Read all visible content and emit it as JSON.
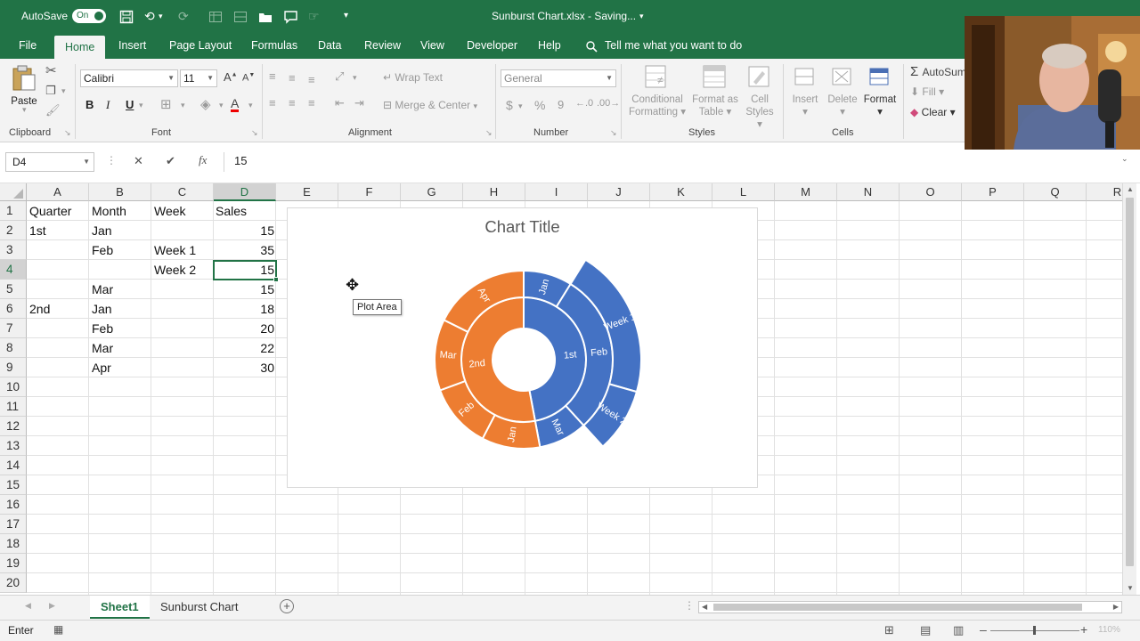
{
  "titlebar": {
    "autosave_label": "AutoSave",
    "autosave_state": "On",
    "filename": "Sunburst Chart.xlsx  -  Saving...",
    "bg_color": "#217346"
  },
  "menu": {
    "tabs": [
      "File",
      "Home",
      "Insert",
      "Page Layout",
      "Formulas",
      "Data",
      "Review",
      "View",
      "Developer",
      "Help"
    ],
    "active_tab": "Home",
    "tell_me": "Tell me what you want to do"
  },
  "ribbon": {
    "clipboard": {
      "label": "Clipboard",
      "paste": "Paste"
    },
    "font": {
      "label": "Font",
      "font_name": "Calibri",
      "font_size": "11",
      "bold": "B",
      "italic": "I",
      "underline": "U"
    },
    "alignment": {
      "label": "Alignment",
      "wrap_text": "Wrap Text",
      "merge_center": "Merge & Center"
    },
    "number": {
      "label": "Number",
      "format": "General",
      "currency": "$",
      "percent": "%",
      "comma": "9"
    },
    "styles": {
      "label": "Styles",
      "conditional_1": "Conditional",
      "conditional_2": "Formatting",
      "format_as_1": "Format as",
      "format_as_2": "Table",
      "cell_styles_1": "Cell",
      "cell_styles_2": "Styles"
    },
    "cells": {
      "label": "Cells",
      "insert": "Insert",
      "delete": "Delete",
      "format": "Format"
    },
    "editing": {
      "autosum": "AutoSum",
      "fill": "Fill",
      "clear": "Clear"
    }
  },
  "formula_bar": {
    "name_box": "D4",
    "cancel": "✕",
    "enter": "✔",
    "fx": "fx",
    "value": "15"
  },
  "grid": {
    "columns": [
      "A",
      "B",
      "C",
      "D",
      "E",
      "F",
      "G",
      "H",
      "I",
      "J",
      "K",
      "L",
      "M",
      "N",
      "O",
      "P",
      "Q",
      "R"
    ],
    "rows": [
      "1",
      "2",
      "3",
      "4",
      "5",
      "6",
      "7",
      "8",
      "9",
      "10",
      "11",
      "12",
      "13",
      "14",
      "15",
      "16",
      "17",
      "18",
      "19",
      "20"
    ],
    "selected_column": "D",
    "selected_row": "4",
    "data": {
      "a1": "Quarter",
      "b1": "Month",
      "c1": "Week",
      "d1": "Sales",
      "a2": "1st",
      "b2": "Jan",
      "d2": "15",
      "b3": "Feb",
      "c3": "Week 1",
      "d3": "35",
      "c4": "Week 2",
      "d4": "15",
      "b5": "Mar",
      "d5": "15",
      "a6": "2nd",
      "b6": "Jan",
      "d6": "18",
      "b7": "Feb",
      "d7": "20",
      "b8": "Mar",
      "d8": "22",
      "b9": "Apr",
      "d9": "30"
    }
  },
  "chart": {
    "title": "Chart Title",
    "tooltip": "Plot Area"
  },
  "chart_data": {
    "type": "sunburst",
    "title": "Chart Title",
    "colors": {
      "1st": "#4472c4",
      "2nd": "#ed7d31"
    },
    "hierarchy": [
      {
        "name": "1st",
        "children": [
          {
            "name": "Jan",
            "value": 15
          },
          {
            "name": "Feb",
            "children": [
              {
                "name": "Week 1",
                "value": 35
              },
              {
                "name": "Week 2",
                "value": 15
              }
            ]
          },
          {
            "name": "Mar",
            "value": 15
          }
        ]
      },
      {
        "name": "2nd",
        "children": [
          {
            "name": "Jan",
            "value": 18
          },
          {
            "name": "Feb",
            "value": 20
          },
          {
            "name": "Mar",
            "value": 22
          },
          {
            "name": "Apr",
            "value": 30
          }
        ]
      }
    ]
  },
  "sheets": {
    "tabs": [
      "Sheet1",
      "Sunburst Chart"
    ],
    "active": "Sheet1"
  },
  "status": {
    "mode": "Enter",
    "zoom": "110%"
  }
}
